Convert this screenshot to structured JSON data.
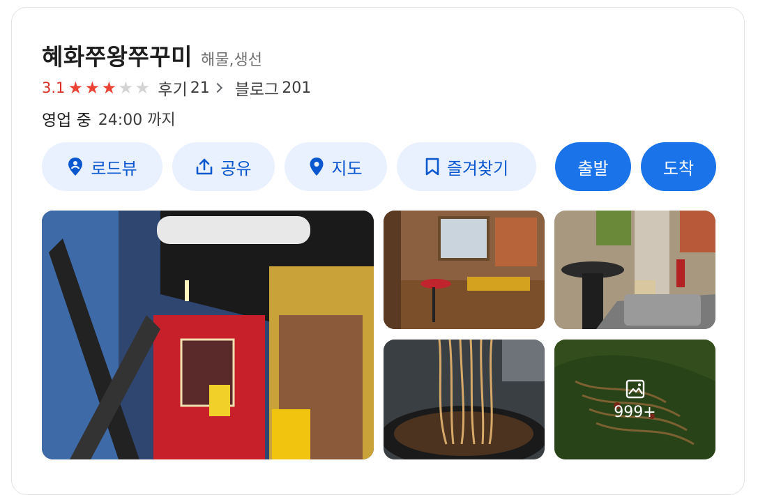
{
  "place": {
    "name": "혜화쭈왕쭈꾸미",
    "category": "해물,생선",
    "rating": "3.1",
    "stars_filled": 3,
    "stars_total": 5,
    "review_label": "후기",
    "review_count": "21",
    "blog_label": "블로그",
    "blog_count": "201",
    "status": "영업 중",
    "hours": "24:00 까지"
  },
  "actions": {
    "roadview": "로드뷰",
    "share": "공유",
    "map": "지도",
    "save": "즐겨찾기",
    "depart": "출발",
    "arrive": "도착"
  },
  "photos": {
    "more_count": "999+"
  },
  "colors": {
    "accent": "#1a73e8",
    "accent_light": "#eaf1fe",
    "rating": "#d93025",
    "star_on": "#ea4335",
    "star_off": "#d3d3d3"
  },
  "icons": {
    "roadview": "roadview-pin-icon",
    "share": "share-icon",
    "map": "map-pin-icon",
    "save": "bookmark-icon",
    "gallery": "image-icon",
    "chevron": "chevron-right-icon"
  }
}
